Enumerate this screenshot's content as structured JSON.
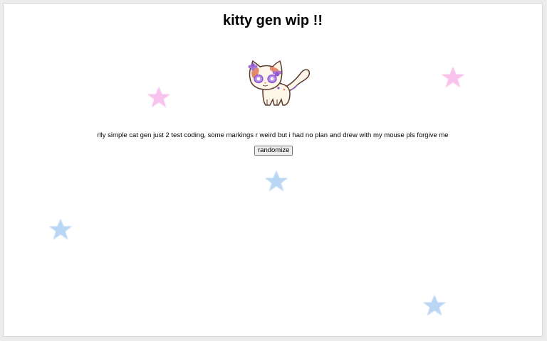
{
  "page": {
    "title": "kitty gen wip !!",
    "description": "rlly simple cat gen just 2 test coding, some markings r weird but i had no plan and drew with my mouse pls forgive me",
    "randomize_label": "randomize"
  },
  "decor": {
    "stars": [
      {
        "color": "#f7c2ee",
        "name": "pink-star-left"
      },
      {
        "color": "#f7c2ee",
        "name": "pink-star-right"
      },
      {
        "color": "#b9d6f5",
        "name": "blue-star-center"
      },
      {
        "color": "#b9d6f5",
        "name": "blue-star-left"
      },
      {
        "color": "#b9d6f5",
        "name": "blue-star-bottom-right"
      }
    ]
  },
  "cat": {
    "icon": "cat-sprite",
    "colors": {
      "outline": "#5a3a2e",
      "body": "#fff6ea",
      "patch": "#e48a6a",
      "markings": "#8f57c9"
    }
  }
}
